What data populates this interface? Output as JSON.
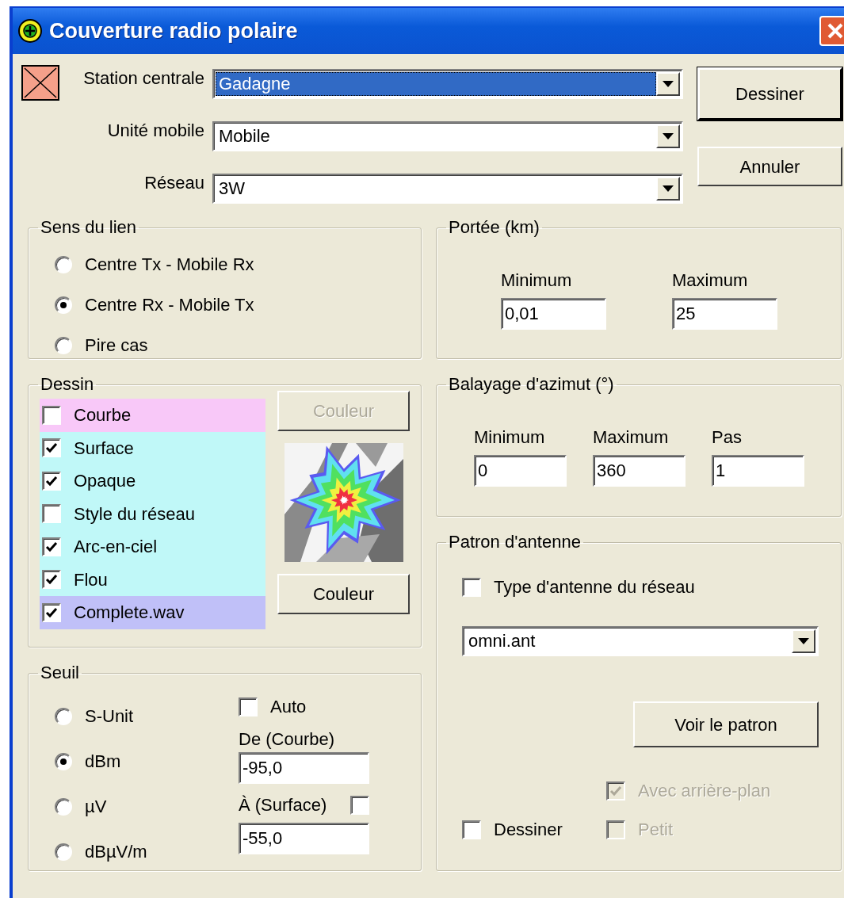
{
  "window": {
    "title": "Couverture radio polaire"
  },
  "fields": [
    {
      "label": "Station centrale",
      "value": "Gadagne",
      "highlighted": true
    },
    {
      "label": "Unité mobile",
      "value": "Mobile",
      "highlighted": false
    },
    {
      "label": "Réseau",
      "value": "3W",
      "highlighted": false
    }
  ],
  "buttons": [
    {
      "label": "Dessiner",
      "default": true
    },
    {
      "label": "Annuler",
      "default": false
    }
  ],
  "link_direction": {
    "title": "Sens du lien",
    "options": [
      {
        "label": "Centre Tx - Mobile Rx",
        "selected": false
      },
      {
        "label": "Centre Rx - Mobile Tx",
        "selected": true
      },
      {
        "label": "Pire cas",
        "selected": false
      }
    ]
  },
  "range": {
    "title": "Portée (km)",
    "fields": [
      {
        "label": "Minimum",
        "value": "0,01"
      },
      {
        "label": "Maximum",
        "value": "25"
      }
    ]
  },
  "drawing": {
    "title": "Dessin",
    "layers": [
      {
        "label": "Courbe",
        "checked": false,
        "color": "#f8c8f8"
      },
      {
        "label": "Surface",
        "checked": true,
        "color": "#c0f8f8"
      },
      {
        "label": "Opaque",
        "checked": true,
        "color": "#c0f8f8"
      },
      {
        "label": "Style du réseau",
        "checked": false,
        "color": "#c0f8f8"
      },
      {
        "label": "Arc-en-ciel",
        "checked": true,
        "color": "#c0f8f8"
      },
      {
        "label": "Flou",
        "checked": true,
        "color": "#c0f8f8"
      },
      {
        "label": "Complete.wav",
        "checked": true,
        "color": "#c0c0f8"
      }
    ],
    "color_buttons": [
      {
        "label": "Couleur",
        "disabled": true
      },
      {
        "label": "Couleur",
        "disabled": false
      }
    ]
  },
  "azimuth": {
    "title": "Balayage d'azimut (°)",
    "fields": [
      {
        "label": "Minimum",
        "value": "0"
      },
      {
        "label": "Maximum",
        "value": "360"
      },
      {
        "label": "Pas",
        "value": "1"
      }
    ]
  },
  "threshold": {
    "title": "Seuil",
    "units": [
      {
        "label": "S-Unit",
        "selected": false
      },
      {
        "label": "dBm",
        "selected": true
      },
      {
        "label": "µV",
        "selected": false
      },
      {
        "label": "dBµV/m",
        "selected": false
      }
    ],
    "auto": {
      "label": "Auto",
      "checked": false
    },
    "from": {
      "label": "De (Courbe)",
      "value": "-95,0"
    },
    "to": {
      "label": "À (Surface)",
      "checked": false,
      "value": "-55,0"
    }
  },
  "antenna": {
    "title": "Patron d'antenne",
    "network_type": {
      "label": "Type d'antenne du réseau",
      "checked": false
    },
    "file": "omni.ant",
    "view_button": "Voir le patron",
    "options": [
      {
        "label": "Dessiner",
        "checked": false,
        "disabled": false
      },
      {
        "label": "Avec arrière-plan",
        "checked": true,
        "disabled": true
      },
      {
        "label": "Petit",
        "checked": false,
        "disabled": true
      }
    ]
  }
}
